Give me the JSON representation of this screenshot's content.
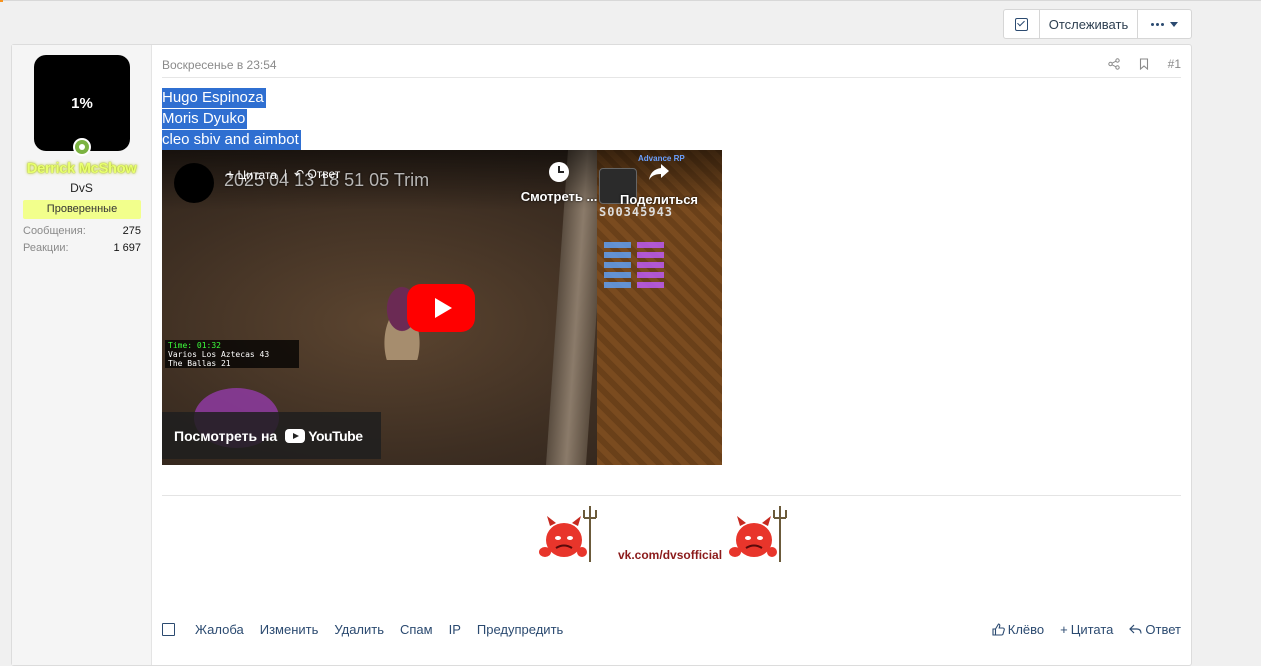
{
  "actionbar": {
    "follow_label": "Отслеживать"
  },
  "user": {
    "avatar_text": "1%",
    "name": "Derrick McShow",
    "title": "DvS",
    "banner": "Проверенные",
    "stats": [
      {
        "label": "Сообщения:",
        "value": "275"
      },
      {
        "label": "Реакции:",
        "value": "1 697"
      }
    ]
  },
  "post": {
    "date": "Воскресенье в 23:54",
    "number": "#1",
    "lines": [
      "Hugo Espinoza",
      "Moris Dyuko",
      "cleo sbiv and aimbot"
    ]
  },
  "video": {
    "title": "2025 04 13 18 51 05 Trim",
    "quote_label": "Цитата",
    "reply_label": "Ответ",
    "watch_later": "Смотреть ...",
    "share": "Поделиться",
    "watch_on": "Посмотреть на",
    "youtube": "YouTube",
    "hud_time": "Time: 01:32",
    "hud_row1": "Varios Los Aztecas  43",
    "hud_row2": "The Ballas  21",
    "watermark": "Advance RP"
  },
  "signature": {
    "link": "vk.com/dvsofficial"
  },
  "footer": {
    "left": [
      "Жалоба",
      "Изменить",
      "Удалить",
      "Спам",
      "IP",
      "Предупредить"
    ],
    "like": "Клёво",
    "quote": "Цитата",
    "reply": "Ответ"
  },
  "colors": {
    "selection": "#2f6fd1",
    "link": "#2b4a70",
    "username": "#e8ff70",
    "banner": "#f2ff8c",
    "youtube_red": "#ff0000"
  }
}
